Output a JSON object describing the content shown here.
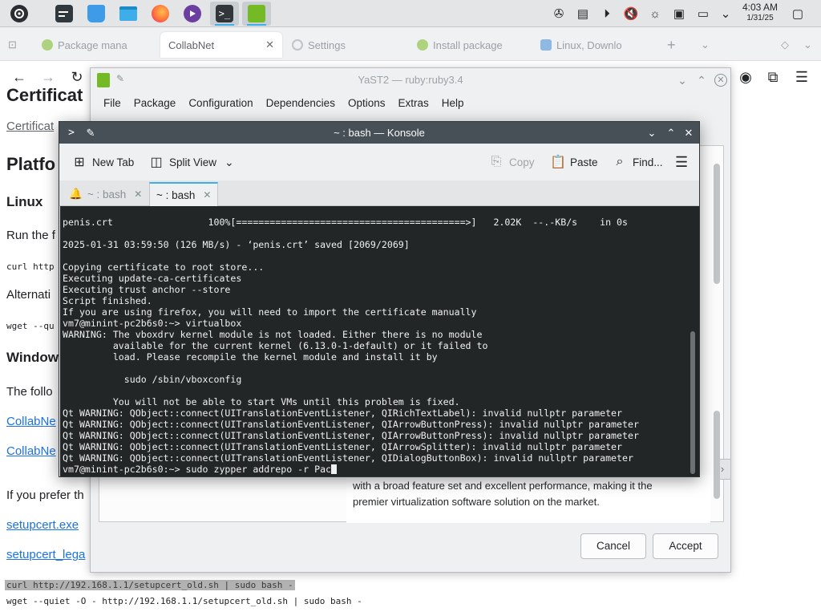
{
  "taskbar": {
    "apps": [
      {
        "name": "app-launcher",
        "icon": "opensuse-logo-icon",
        "color": "#2a2e33"
      },
      {
        "name": "system-settings",
        "icon": "settings-panel-icon",
        "color": "#30373d"
      },
      {
        "name": "discover",
        "icon": "store-bag-icon",
        "color": "#3d9be8"
      },
      {
        "name": "dolphin",
        "icon": "folder-icon",
        "color": "#3daee9"
      },
      {
        "name": "firefox",
        "icon": "firefox-icon",
        "color": "#ff7139"
      },
      {
        "name": "media",
        "icon": "media-player-icon",
        "color": "#6b3fa0"
      },
      {
        "name": "konsole",
        "icon": "terminal-icon",
        "color": "#31363b"
      },
      {
        "name": "yast",
        "icon": "yast-package-icon",
        "color": "#73ba25"
      }
    ],
    "clock": {
      "time": "4:03 AM",
      "date": "1/31/25"
    }
  },
  "browser": {
    "tabs": [
      {
        "label": "Package mana",
        "icon": "opensuse-chameleon-icon"
      },
      {
        "label": "CollabNet",
        "close": "✕"
      },
      {
        "label": "Settings",
        "icon": "gear-icon"
      },
      {
        "label": "Install package",
        "icon": "opensuse-chameleon-icon"
      },
      {
        "label": "Linux, Downlo",
        "icon": "virtualbox-icon"
      }
    ],
    "new_tab": "+"
  },
  "page": {
    "heading_partial": "Certificat",
    "certificate_link": "Certificat",
    "platforms_heading": "Platfo",
    "linux_heading": "Linux",
    "run_text": "Run the f",
    "curl_partial": "curl http",
    "alternative_text": "Alternati",
    "wget_partial": "wget --qu",
    "windows_heading": "Window",
    "following_text": "The follo",
    "collabnet_link_1": "CollabNe",
    "collabnet_link_2": "CollabNe",
    "prefer_text": "If you prefer th",
    "setupcert_exe": "setupcert.exe",
    "setupcert_legacy": "setupcert_lega",
    "curl_command": "curl http://192.168.1.1/setupcert_old.sh | sudo bash -",
    "wget_command": "wget --quiet -O - http://192.168.1.1/setupcert_old.sh | sudo bash -"
  },
  "yast": {
    "title": "YaST2 — ruby:ruby3.4",
    "menu": [
      "File",
      "Package",
      "Configuration",
      "Dependencies",
      "Options",
      "Extras",
      "Help"
    ],
    "description_lines": [
      "with a broad feature set and excellent performance, making it the",
      "premier virtualization software solution on the market."
    ],
    "buttons": {
      "cancel": "Cancel",
      "accept": "Accept"
    }
  },
  "konsole": {
    "title": "~ : bash — Konsole",
    "toolbar": {
      "new_tab": "New Tab",
      "split_view": "Split View",
      "copy": "Copy",
      "paste": "Paste",
      "find": "Find..."
    },
    "tabs": [
      {
        "label": "~ : bash",
        "active": false
      },
      {
        "label": "~ : bash",
        "active": true
      }
    ],
    "terminal_lines": [
      "penis.crt                 100%[=========================================>]   2.02K  --.-KB/s    in 0s",
      "",
      "2025-01-31 03:59:50 (126 MB/s) - ‘penis.crt’ saved [2069/2069]",
      "",
      "Copying certificate to root store...",
      "Executing update-ca-certificates",
      "Executing trust anchor --store",
      "Script finished.",
      "If you are using firefox, you will need to import the certificate manually",
      "vm7@minint-pc2b6s0:~> virtualbox",
      "WARNING: The vboxdrv kernel module is not loaded. Either there is no module",
      "         available for the current kernel (6.13.0-1-default) or it failed to",
      "         load. Please recompile the kernel module and install it by",
      "",
      "           sudo /sbin/vboxconfig",
      "",
      "         You will not be able to start VMs until this problem is fixed.",
      "Qt WARNING: QObject::connect(UITranslationEventListener, QIRichTextLabel): invalid nullptr parameter",
      "Qt WARNING: QObject::connect(UITranslationEventListener, QIArrowButtonPress): invalid nullptr parameter",
      "Qt WARNING: QObject::connect(UITranslationEventListener, QIArrowButtonPress): invalid nullptr parameter",
      "Qt WARNING: QObject::connect(UITranslationEventListener, QIArrowSplitter): invalid nullptr parameter",
      "Qt WARNING: QObject::connect(UITranslationEventListener, QIDialogButtonBox): invalid nullptr parameter"
    ],
    "prompt_line": "vm7@minint-pc2b6s0:~> sudo zypper addrepo -r Pac"
  }
}
